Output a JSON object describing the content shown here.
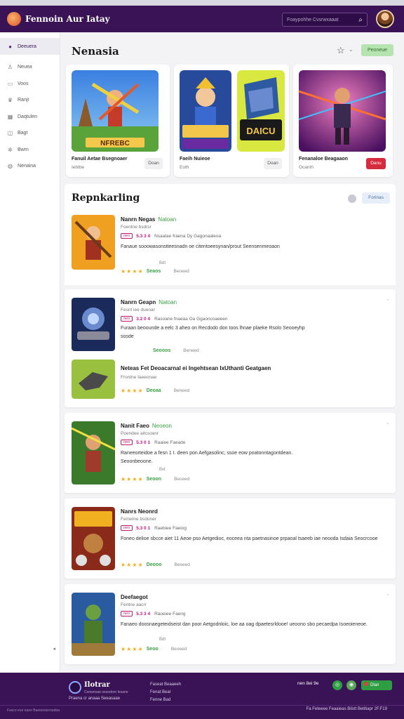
{
  "app": {
    "title": "Fennoin Aur Iatay"
  },
  "search": {
    "placeholder": "Foaypohhe Cvsrwxaaat"
  },
  "colors": {
    "header": "#3a1357",
    "accent_green": "#3ba246",
    "accent_red": "#d62b3c",
    "accent_magenta": "#c2187a",
    "star": "#f0b020"
  },
  "sidebar": {
    "items": [
      {
        "label": "Deeuera",
        "icon": "home-icon"
      },
      {
        "label": "Neuea",
        "icon": "person-icon"
      },
      {
        "label": "Voos",
        "icon": "video-icon"
      },
      {
        "label": "Ranjt",
        "icon": "trophy-icon"
      },
      {
        "label": "Daqtulen",
        "icon": "calendar-icon"
      },
      {
        "label": "Bagt",
        "icon": "bag-icon"
      },
      {
        "label": "Bwrn",
        "icon": "gear-icon"
      },
      {
        "label": "Nenaina",
        "icon": "globe-icon"
      }
    ],
    "collapse_glyph": "◂"
  },
  "main": {
    "title": "Nenasia",
    "primary_label": "Peoneue"
  },
  "featured": [
    {
      "title": "Fanuil Aetae Bsegnoaer",
      "sub": "Iebtbe",
      "art_label": "NFREBC",
      "button": "Doan"
    },
    {
      "title": "Faeih Nuieoe",
      "sub": "Eoth",
      "art_label": "DAICU",
      "button": "Doan"
    },
    {
      "title": "Fenanaloe Beagaaon",
      "sub": "Ocanth",
      "art_label": "",
      "button": "Danu"
    }
  ],
  "ranking": {
    "title": "Repnkarling",
    "button": "Forinas",
    "entries": [
      {
        "title": "Nanrn Negas",
        "tag": "Natoan",
        "sub": "Foentne bsdrsr",
        "badge": "neo",
        "score": "5.3 3 4",
        "meta": "Nsaatae fraena Dy Gagonaaleoa",
        "desc": "Fanaue sooowasonstteesnadn oe citentoeesynan/prout Seensenmeoaon",
        "small": "Bdt",
        "stars": "★★★★",
        "rating": "Seaos",
        "rating_label": "Beoeed"
      },
      {
        "title": "Nanrn Geapn",
        "tag": "Natoan",
        "sub": "Fesnt iee dueoar",
        "badge": "neo",
        "score": "3.2 0 4",
        "meta": "Rasoane fnaeaa Oa Ggaoncoaeeen",
        "desc": "Furaan beoounde a eelc 3 aheo on Recdodo don toos lhnae plaeke Rsolo Seooeyhp sosde",
        "small": "",
        "stars": "",
        "rating": "Seooos",
        "rating_label": "Beneed"
      },
      {
        "title": "Neteas Fet Deoacarnal ei Ingehtsean IxUthanti Geatgaen",
        "tag": "",
        "sub": "Frontne taeeonae",
        "badge": "",
        "score": "",
        "meta": "",
        "desc": "",
        "small": "",
        "stars": "★★★★",
        "rating": "Deoaa",
        "rating_label": "Beneed"
      },
      {
        "title": "Nanit Faeo",
        "tag": "Neoeon",
        "sub": "Poendee aitcsoanr",
        "badge": "neo",
        "score": "5.3 0 1",
        "meta": "Raaiee Faeade",
        "desc": "Raneeorteidoe a fesn 1 I. deen pon Aefgasolinc; ssoe eow poatonntagontdean. Seoonbeoone.",
        "small": "Bxt",
        "stars": "★★★★",
        "rating": "Seoon",
        "rating_label": "Beceed"
      },
      {
        "title": "Nanrs Neonrd",
        "tag": "",
        "sub": "Femetne bsdoner",
        "badge": "neo",
        "score": "5.3 0 1",
        "meta": "Raebiee Faeiog",
        "desc": "Foneo delioe sbcce aiet 11 Aeoe pso Aetgedioc, eoceea nta paetnasinoe prpaoal tsaeeb iae neooda Isdaia Seocrcooe",
        "small": "",
        "stars": "★★★★",
        "rating": "Deooo",
        "rating_label": "Beeeed"
      },
      {
        "title": "Deefaegot",
        "tag": "",
        "sub": "Fentne aacrr",
        "badge": "neo",
        "score": "5.3 3 4",
        "meta": "Raoeiee Faeng",
        "desc": "Fanaeo doosnaegeteidseist dan poor Aetgodnloic, loe aa oag dpaetesrldooe! ueoono sbo pecaedpa Isoeoieneoe.",
        "small": "Bdt",
        "stars": "★★★★",
        "rating": "Seoo",
        "rating_label": "Beoeed"
      }
    ]
  },
  "footer": {
    "brand": "Ilotrar",
    "tagline": "Conwnoae oesodonr Iesane",
    "copy": "Praena cr anaaa Seeasaae",
    "links": [
      "Faseat Beaaeeh",
      "Fenat Bear",
      "Fenne Bad"
    ],
    "social_label": "nen 8ei 9e",
    "cta": "Dlan",
    "bottom_left": "Fasco eoe eaoe Baeeeosrcoadoa",
    "bottom_right": "Fa Feteeee    Feaaieas    Bilstt Betitiapr 2F.F19"
  }
}
